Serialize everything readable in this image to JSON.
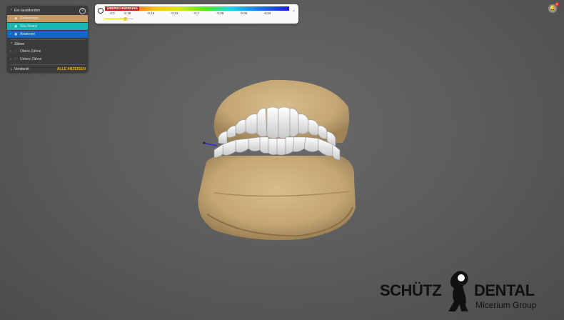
{
  "panel": {
    "header": "Ein-/ausblenden",
    "help_icon": "?",
    "items": [
      {
        "label": "Referenzen",
        "color": "#c79a63"
      },
      {
        "label": "Situ-Scans",
        "color": "#14b8b0"
      },
      {
        "label": "Anatomie",
        "color": "#1565c8"
      }
    ],
    "teeth_header": "Zähne",
    "teeth_items": [
      {
        "label": "Obere Zähne"
      },
      {
        "label": "Untere Zähne"
      }
    ],
    "hidden_header": "Versteckt",
    "show_all": "ALLE ANZEIGEN"
  },
  "scale": {
    "title": "ÜBERSCHNEIDUNG",
    "ticks": [
      "-0,2",
      "-0,18",
      "-0,15",
      "-0,13",
      "-0,1",
      "-0,08",
      "-0,05",
      "-0,03"
    ],
    "slider_value": 0.7
  },
  "notification": {
    "count": "4"
  },
  "logo": {
    "word1": "SCHÜTZ",
    "word2": "DENTAL",
    "sub": "Micerium Group"
  }
}
